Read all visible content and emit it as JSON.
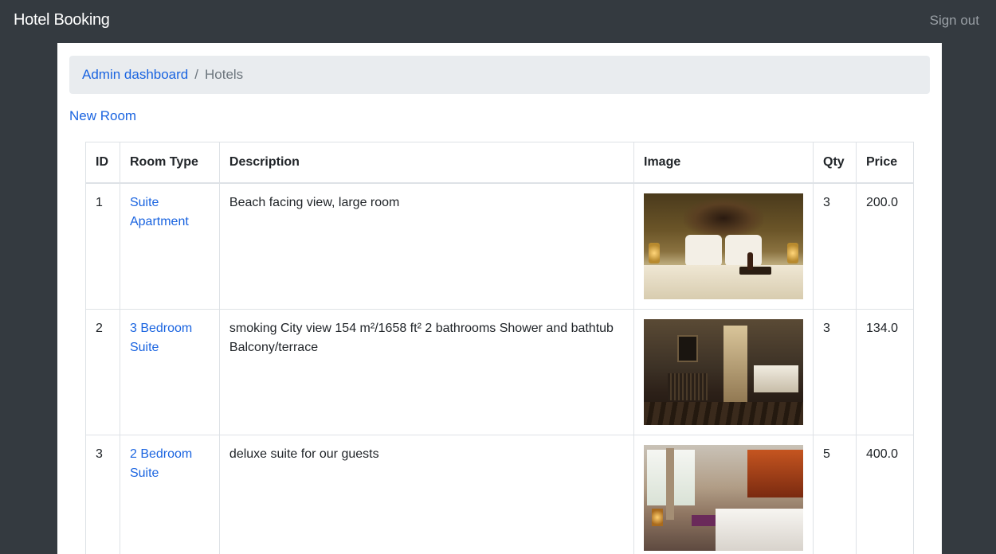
{
  "navbar": {
    "brand": "Hotel Booking",
    "sign_out": "Sign out"
  },
  "breadcrumb": {
    "home": "Admin dashboard",
    "separator": "/",
    "current": "Hotels"
  },
  "actions": {
    "new_room": "New Room"
  },
  "table": {
    "headers": {
      "id": "ID",
      "room_type": "Room Type",
      "description": "Description",
      "image": "Image",
      "qty": "Qty",
      "price": "Price"
    },
    "rows": [
      {
        "id": "1",
        "room_type": "Suite Apartment",
        "description": "Beach facing view, large room",
        "qty": "3",
        "price": "200.0"
      },
      {
        "id": "2",
        "room_type": "3 Bedroom Suite",
        "description": "smoking City view 154 m²/1658 ft² 2 bathrooms Shower and bathtub Balcony/terrace",
        "qty": "3",
        "price": "134.0"
      },
      {
        "id": "3",
        "room_type": "2 Bedroom Suite",
        "description": "deluxe suite for our guests",
        "qty": "5",
        "price": "400.0"
      }
    ]
  },
  "colors": {
    "navbar_bg": "#343a40",
    "link": "#1a64e0",
    "breadcrumb_bg": "#e9ecef"
  }
}
